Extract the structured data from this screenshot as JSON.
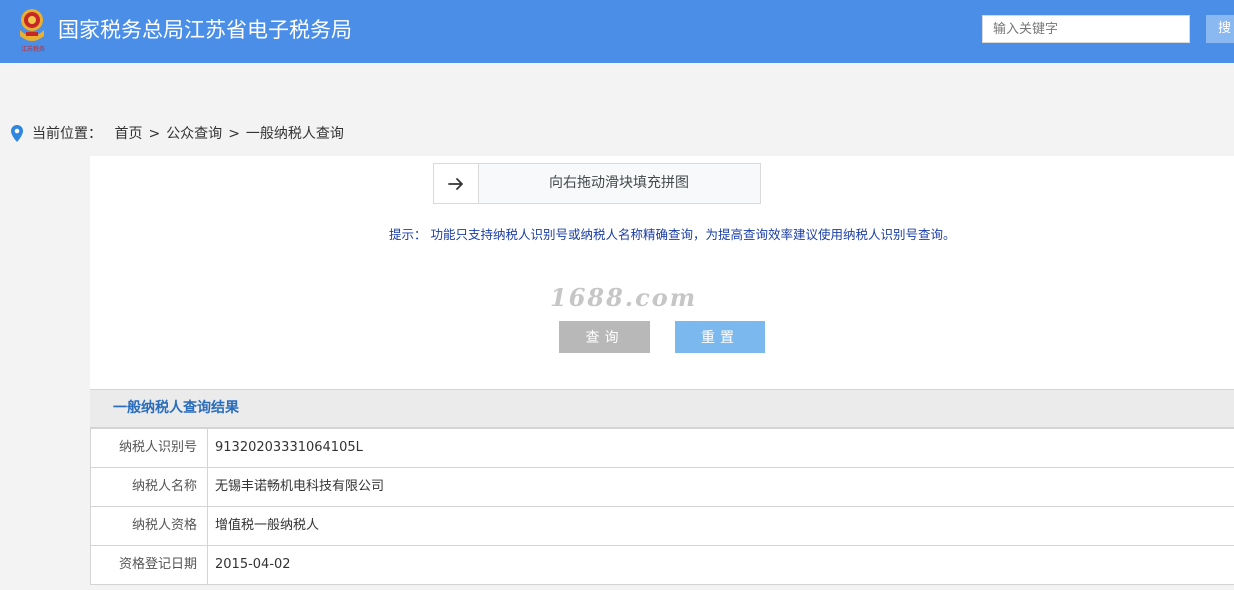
{
  "header": {
    "logo_text": "江苏税务",
    "title": "国家税务总局江苏省电子税务局",
    "search_placeholder": "输入关键字",
    "search_button": "搜"
  },
  "breadcrumb": {
    "label": "当前位置：",
    "items": [
      "首页",
      "公众查询",
      "一般纳税人查询"
    ],
    "separator": ">"
  },
  "slider": {
    "text": "向右拖动滑块填充拼图"
  },
  "hint": "提示： 功能只支持纳税人识别号或纳税人名称精确查询，为提高查询效率建议使用纳税人识别号查询。",
  "watermark": "1688.com",
  "buttons": {
    "query": "查询",
    "reset": "重置"
  },
  "result": {
    "title": "一般纳税人查询结果",
    "rows": [
      {
        "label": "纳税人识别号",
        "value": "91320203331064105L"
      },
      {
        "label": "纳税人名称",
        "value": "无锡丰诺畅机电科技有限公司"
      },
      {
        "label": "纳税人资格",
        "value": "增值税一般纳税人"
      },
      {
        "label": "资格登记日期",
        "value": "2015-04-02"
      }
    ]
  },
  "colors": {
    "header_bg": "#4a8ee8",
    "accent_blue": "#2a6dbd",
    "hint_text": "#1b3ea6",
    "reset_button": "#7bb8ee",
    "query_button": "#b8b8b8"
  }
}
